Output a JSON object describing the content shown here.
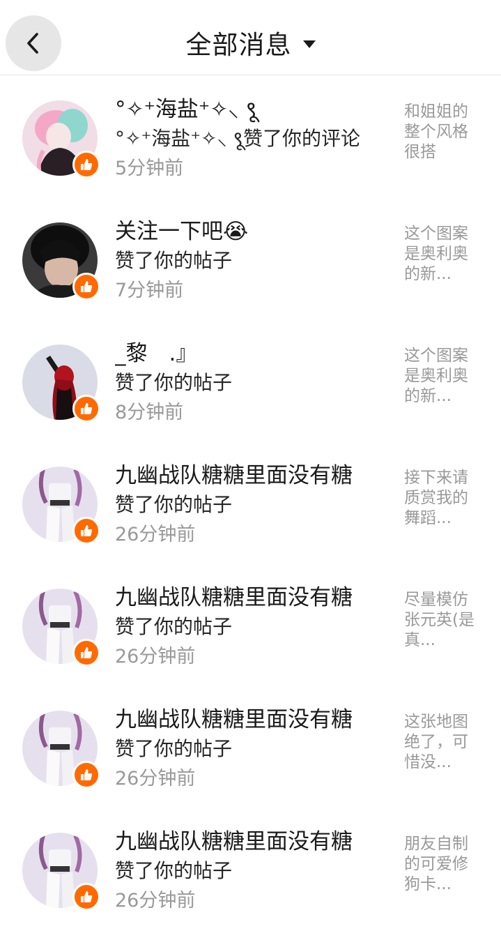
{
  "header": {
    "title": "全部消息"
  },
  "colors": {
    "like_badge": "#ff6a00",
    "secondary_text": "#999999",
    "back_button_bg": "#e6e6e6"
  },
  "notifications": [
    {
      "name": "°✧⁺海盐⁺✧⸜ ९ू",
      "action": "°✧⁺海盐⁺✧⸜ ९ू赞了你的评论",
      "time": "5分钟前",
      "snippet": "和姐姐的整个风格很搭",
      "badge_icon": "thumbs-up-icon"
    },
    {
      "name": "关注一下吧😭",
      "action": "赞了你的帖子",
      "time": "7分钟前",
      "snippet": "这个图案是奥利奥的新...",
      "badge_icon": "thumbs-up-icon"
    },
    {
      "name": "_黎　.』",
      "action": "赞了你的帖子",
      "time": "8分钟前",
      "snippet": "这个图案是奥利奥的新...",
      "badge_icon": "thumbs-up-icon"
    },
    {
      "name": "九幽战队糖糖里面没有糖",
      "action": "赞了你的帖子",
      "time": "26分钟前",
      "snippet": "接下来请质赏我的舞蹈...",
      "badge_icon": "thumbs-up-icon"
    },
    {
      "name": "九幽战队糖糖里面没有糖",
      "action": "赞了你的帖子",
      "time": "26分钟前",
      "snippet": "尽量模仿张元英(是真...",
      "badge_icon": "thumbs-up-icon"
    },
    {
      "name": "九幽战队糖糖里面没有糖",
      "action": "赞了你的帖子",
      "time": "26分钟前",
      "snippet": "这张地图绝了，可惜没...",
      "badge_icon": "thumbs-up-icon"
    },
    {
      "name": "九幽战队糖糖里面没有糖",
      "action": "赞了你的帖子",
      "time": "26分钟前",
      "snippet": "朋友自制的可爱修狗卡...",
      "badge_icon": "thumbs-up-icon"
    }
  ]
}
